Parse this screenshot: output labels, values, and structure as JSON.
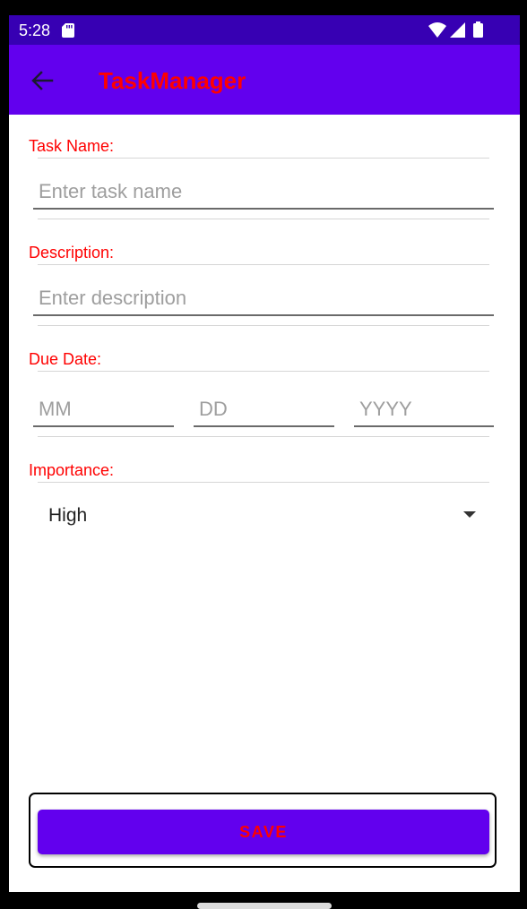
{
  "status_bar": {
    "time": "5:28"
  },
  "app_bar": {
    "title": "TaskManager"
  },
  "form": {
    "task_name": {
      "label": "Task Name:",
      "placeholder": "Enter task name"
    },
    "description": {
      "label": "Description:",
      "placeholder": "Enter description"
    },
    "due_date": {
      "label": "Due Date:",
      "month_placeholder": "MM",
      "day_placeholder": "DD",
      "year_placeholder": "YYYY"
    },
    "importance": {
      "label": "Importance:",
      "selected": "High"
    }
  },
  "actions": {
    "save_label": "SAVE"
  },
  "colors": {
    "status_bar": "#3700B3",
    "app_bar": "#6200EE",
    "accent_text": "#FF0000",
    "button": "#6200EE"
  },
  "icons": [
    "sd-card-icon",
    "wifi-icon",
    "signal-icon",
    "battery-icon",
    "back-arrow-icon",
    "dropdown-arrow-icon"
  ]
}
